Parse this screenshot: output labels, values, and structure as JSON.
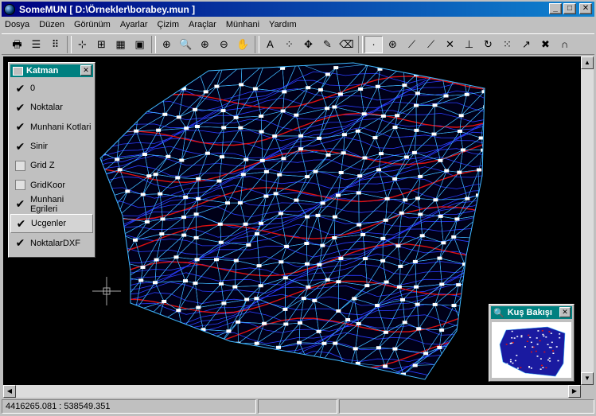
{
  "window": {
    "title": "SomeMUN [ D:\\Örnekler\\borabey.mun ]",
    "min_label": "_",
    "max_label": "□",
    "close_label": "✕"
  },
  "menu": [
    "Dosya",
    "Düzen",
    "Görünüm",
    "Ayarlar",
    "Çizim",
    "Araçlar",
    "Münhani",
    "Yardım"
  ],
  "toolbar": {
    "buttons": [
      {
        "icon": "printer-icon",
        "glyph": "🖶"
      },
      {
        "icon": "layers-icon",
        "glyph": "☰"
      },
      {
        "icon": "grid-icon",
        "glyph": "⠿"
      },
      {
        "icon": "line-tool-icon",
        "glyph": "⊹"
      },
      {
        "icon": "table-icon",
        "glyph": "⊞"
      },
      {
        "icon": "profile-icon",
        "glyph": "▦"
      },
      {
        "icon": "monitor-icon",
        "glyph": "▣"
      },
      {
        "icon": "zoom-window-icon",
        "glyph": "⊕"
      },
      {
        "icon": "zoom-icon",
        "glyph": "🔍"
      },
      {
        "icon": "zoom-in-icon",
        "glyph": "⊕"
      },
      {
        "icon": "zoom-out-icon",
        "glyph": "⊖"
      },
      {
        "icon": "pan-hand-icon",
        "glyph": "✋"
      },
      {
        "icon": "text-color-icon",
        "glyph": "A"
      },
      {
        "icon": "points-icon",
        "glyph": "⁘"
      },
      {
        "icon": "move-icon",
        "glyph": "✥"
      },
      {
        "icon": "pencil-icon",
        "glyph": "✎"
      },
      {
        "icon": "eraser-icon",
        "glyph": "⌫"
      },
      {
        "icon": "point-select-icon",
        "glyph": "·"
      },
      {
        "icon": "target-icon",
        "glyph": "⊛"
      },
      {
        "icon": "line-icon",
        "glyph": "⟋"
      },
      {
        "icon": "segment-icon",
        "glyph": "⟋"
      },
      {
        "icon": "intersect-icon",
        "glyph": "✕"
      },
      {
        "icon": "perpendicular-icon",
        "glyph": "⊥"
      },
      {
        "icon": "rotate-icon",
        "glyph": "↻"
      },
      {
        "icon": "dots-icon",
        "glyph": "⁙"
      },
      {
        "icon": "arrow-icon",
        "glyph": "↗"
      },
      {
        "icon": "delete-icon",
        "glyph": "✖"
      },
      {
        "icon": "magnet-icon",
        "glyph": "∩"
      }
    ],
    "pressed_index": 17
  },
  "layer_panel": {
    "title": "Katman",
    "close_label": "✕",
    "items": [
      {
        "label": "0",
        "checked": true
      },
      {
        "label": "Noktalar",
        "checked": true
      },
      {
        "label": "Munhani Kotlari",
        "checked": true
      },
      {
        "label": "Sinir",
        "checked": true
      },
      {
        "label": "Grid Z",
        "checked": false
      },
      {
        "label": "GridKoor",
        "checked": false
      },
      {
        "label": "Munhani Egrileri",
        "checked": true
      },
      {
        "label": "Ucgenler",
        "checked": true,
        "selected": true
      },
      {
        "label": "NoktalarDXF",
        "checked": true
      }
    ]
  },
  "birdview": {
    "title": "Kuş Bakışı",
    "close_label": "✕"
  },
  "status": {
    "coords": "4416265.081 : 538549.351"
  },
  "colors": {
    "canvas_bg": "#000000",
    "contour": "#2a3cff",
    "index_contour": "#e01010",
    "triangle": "#3fb8ff",
    "point": "#ffffff"
  }
}
